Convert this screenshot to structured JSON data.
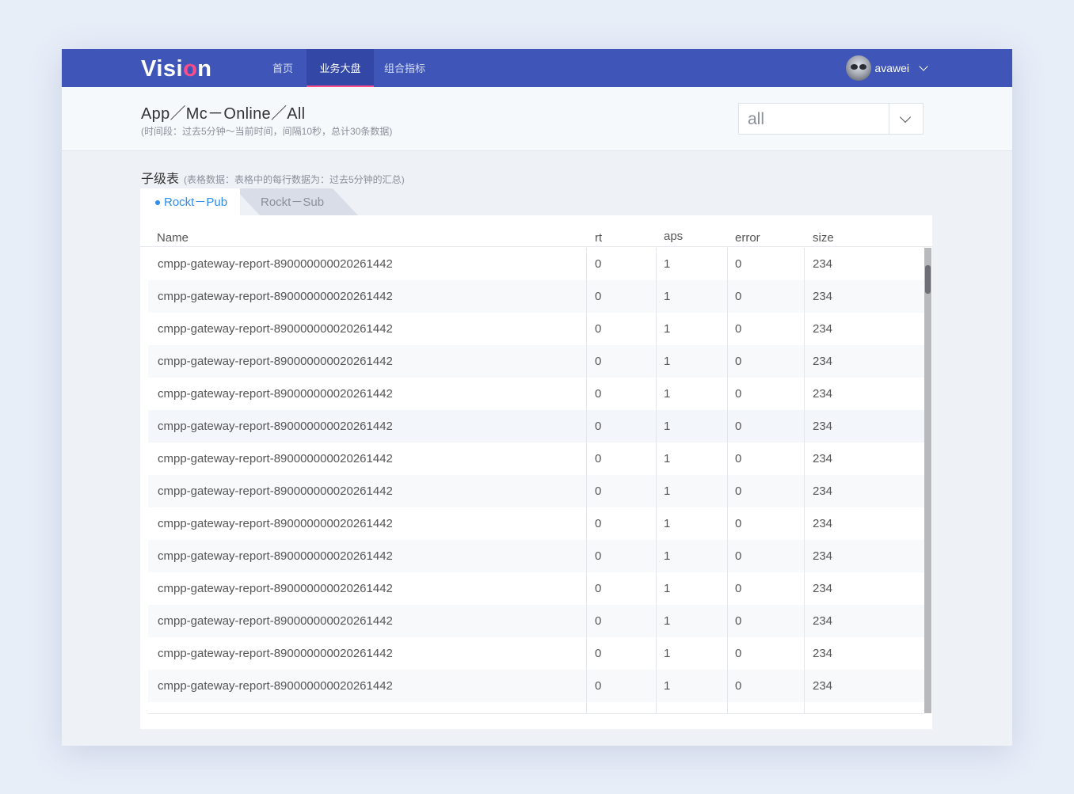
{
  "nav": {
    "logo": {
      "part1": "Visi",
      "part2": "o",
      "part3": "n"
    },
    "items": [
      {
        "label": "首页"
      },
      {
        "label": "业务大盘"
      },
      {
        "label": "组合指标"
      }
    ],
    "user_name": "avawei"
  },
  "header": {
    "breadcrumb": "App／Mc－Online／All",
    "subtitle": "(时间段：过去5分钟～当前时间，间隔10秒，总计30条数据)",
    "filter_value": "all"
  },
  "section": {
    "title": "子级表",
    "note": "(表格数据：表格中的每行数据为：过去5分钟的汇总)",
    "tabs": [
      {
        "label": "Rockt－Pub"
      },
      {
        "label": "Rockt－Sub"
      }
    ]
  },
  "table": {
    "columns": [
      "Name",
      "rt",
      "aps",
      "error",
      "size"
    ],
    "rows": [
      {
        "name": "cmpp-gateway-report-890000000020261442",
        "rt": "0",
        "aps": "1",
        "error": "0",
        "size": "234"
      },
      {
        "name": "cmpp-gateway-report-890000000020261442",
        "rt": "0",
        "aps": "1",
        "error": "0",
        "size": "234"
      },
      {
        "name": "cmpp-gateway-report-890000000020261442",
        "rt": "0",
        "aps": "1",
        "error": "0",
        "size": "234"
      },
      {
        "name": "cmpp-gateway-report-890000000020261442",
        "rt": "0",
        "aps": "1",
        "error": "0",
        "size": "234"
      },
      {
        "name": "cmpp-gateway-report-890000000020261442",
        "rt": "0",
        "aps": "1",
        "error": "0",
        "size": "234"
      },
      {
        "name": "cmpp-gateway-report-890000000020261442",
        "rt": "0",
        "aps": "1",
        "error": "0",
        "size": "234"
      },
      {
        "name": "cmpp-gateway-report-890000000020261442",
        "rt": "0",
        "aps": "1",
        "error": "0",
        "size": "234"
      },
      {
        "name": "cmpp-gateway-report-890000000020261442",
        "rt": "0",
        "aps": "1",
        "error": "0",
        "size": "234"
      },
      {
        "name": "cmpp-gateway-report-890000000020261442",
        "rt": "0",
        "aps": "1",
        "error": "0",
        "size": "234"
      },
      {
        "name": "cmpp-gateway-report-890000000020261442",
        "rt": "0",
        "aps": "1",
        "error": "0",
        "size": "234"
      },
      {
        "name": "cmpp-gateway-report-890000000020261442",
        "rt": "0",
        "aps": "1",
        "error": "0",
        "size": "234"
      },
      {
        "name": "cmpp-gateway-report-890000000020261442",
        "rt": "0",
        "aps": "1",
        "error": "0",
        "size": "234"
      },
      {
        "name": "cmpp-gateway-report-890000000020261442",
        "rt": "0",
        "aps": "1",
        "error": "0",
        "size": "234"
      },
      {
        "name": "cmpp-gateway-report-890000000020261442",
        "rt": "0",
        "aps": "1",
        "error": "0",
        "size": "234"
      }
    ]
  },
  "colors": {
    "nav_bg": "#3f56b8",
    "nav_active": "#3347a6",
    "accent_pink": "#ff4d8a",
    "tab_active": "#2d8cf0"
  }
}
